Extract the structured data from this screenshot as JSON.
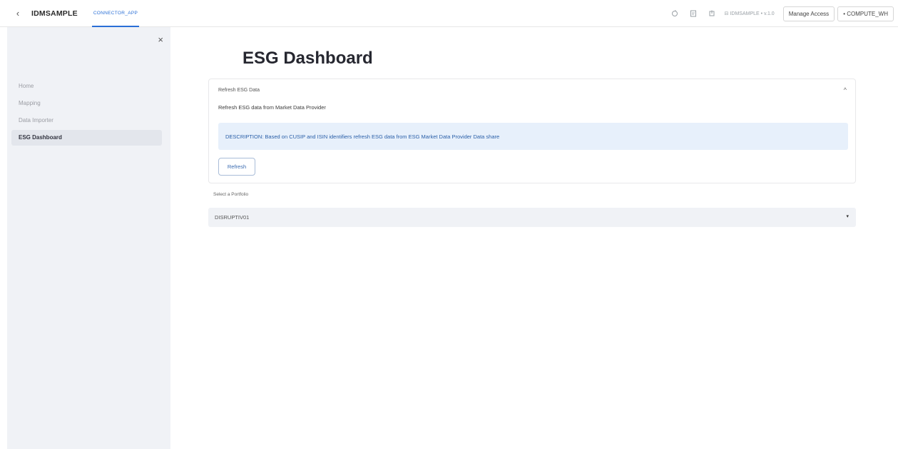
{
  "header": {
    "back_icon": "chevron-left-icon",
    "app_name": "IDMSAMPLE",
    "active_tab": "CONNECTOR_APP",
    "icons": [
      "refresh-icon",
      "code-icon",
      "share-icon"
    ],
    "database_label": "⊟ IDMSAMPLE • v.1.0",
    "manage_access_label": "Manage Access",
    "warehouse_label": "• COMPUTE_WH",
    "accent_color": "#2a6fd6"
  },
  "sidebar": {
    "close_label": "×",
    "items": [
      {
        "label": "Home",
        "active": false
      },
      {
        "label": "Mapping",
        "active": false
      },
      {
        "label": "Data Importer",
        "active": false
      },
      {
        "label": "ESG Dashboard",
        "active": true
      }
    ]
  },
  "main": {
    "title": "ESG Dashboard",
    "expander": {
      "header": "Refresh ESG Data",
      "chevron": "^",
      "subtitle": "Refresh ESG data from Market Data Provider",
      "info": "DESCRIPTION: Based on CUSIP and ISIN identifiers refresh ESG data from ESG Market Data Provider Data share",
      "refresh_label": "Refresh"
    },
    "portfolio_select": {
      "label": "Select a Portfolio",
      "value": "DISRUPTIV01",
      "arrow": "▾"
    }
  }
}
